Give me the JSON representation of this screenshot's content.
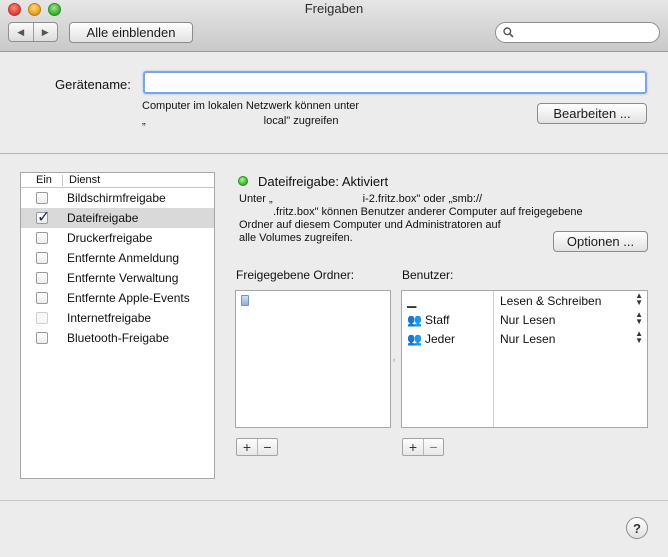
{
  "window": {
    "title": "Freigaben"
  },
  "toolbar": {
    "back": "◀",
    "forward": "▶",
    "show_all": "Alle einblenden",
    "search_placeholder": "",
    "search_icon": "magnifier-icon"
  },
  "header": {
    "device_name_label": "Gerätename:",
    "device_name_value": "",
    "info_line1": "Computer im lokalen Netzwerk können unter",
    "info_line2_start": "„",
    "info_line2_end": "local\" zugreifen",
    "edit_button": "Bearbeiten ..."
  },
  "services": {
    "col_on": "Ein",
    "col_service": "Dienst",
    "items": [
      {
        "label": "Bildschirmfreigabe",
        "checked": false,
        "enabled": true
      },
      {
        "label": "Dateifreigabe",
        "checked": true,
        "enabled": true,
        "selected": true
      },
      {
        "label": "Druckerfreigabe",
        "checked": false,
        "enabled": true
      },
      {
        "label": "Entfernte Anmeldung",
        "checked": false,
        "enabled": true
      },
      {
        "label": "Entfernte Verwaltung",
        "checked": false,
        "enabled": true
      },
      {
        "label": "Entfernte Apple-Events",
        "checked": false,
        "enabled": true
      },
      {
        "label": "Internetfreigabe",
        "checked": false,
        "enabled": false
      },
      {
        "label": "Bluetooth-Freigabe",
        "checked": false,
        "enabled": true
      }
    ]
  },
  "detail": {
    "status_color": "#3cc130",
    "status": "Dateifreigabe: Aktiviert",
    "desc_line1": "Unter „",
    "desc_line1_mid": "i-2.fritz.box\" oder „smb://",
    "desc_line2_end": ".fritz.box\" können Benutzer anderer Computer auf freigegebene",
    "desc_line3": "Ordner auf diesem Computer und Administratoren auf",
    "desc_line4": "alle Volumes zugreifen.",
    "options_button": "Optionen ...",
    "folders_header": "Freigegebene Ordner:",
    "users_header": "Benutzer:",
    "users": [
      {
        "name": "",
        "permission": "Lesen & Schreiben",
        "icon": "user-icon"
      },
      {
        "name": "Staff",
        "permission": "Nur Lesen",
        "icon": "group-icon"
      },
      {
        "name": "Jeder",
        "permission": "Nur Lesen",
        "icon": "group-icon"
      }
    ],
    "add": "+",
    "remove": "−"
  },
  "footer": {
    "help": "?"
  }
}
